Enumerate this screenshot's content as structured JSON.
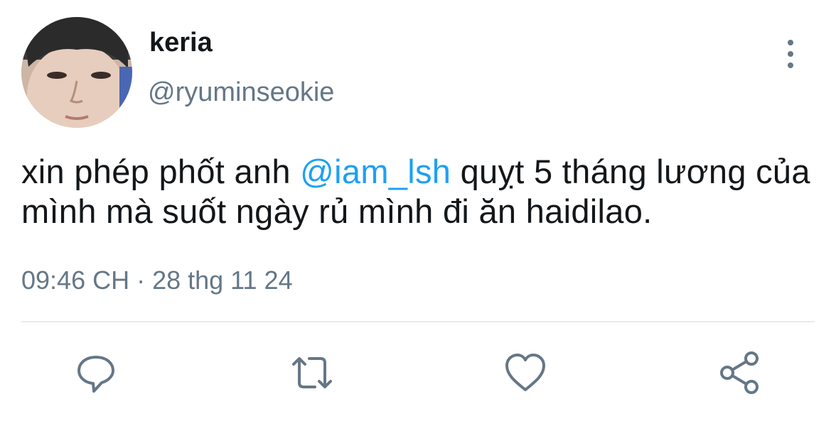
{
  "user": {
    "display_name": "keria",
    "handle": "@ryuminseokie"
  },
  "tweet": {
    "text_before": "xin phép phốt anh ",
    "mention": "@iam_lsh",
    "text_after": " quỵt 5 tháng lương của mình mà suốt ngày rủ mình đi ăn haidilao.",
    "timestamp": "09:46 CH · 28 thg 11 24"
  },
  "icons": {
    "more": "more-vertical-icon",
    "reply": "reply-icon",
    "retweet": "retweet-icon",
    "like": "heart-icon",
    "share": "share-icon"
  },
  "colors": {
    "text": "#14171a",
    "secondary": "#657786",
    "link": "#1da1f2",
    "divider": "#e6ecf0"
  }
}
